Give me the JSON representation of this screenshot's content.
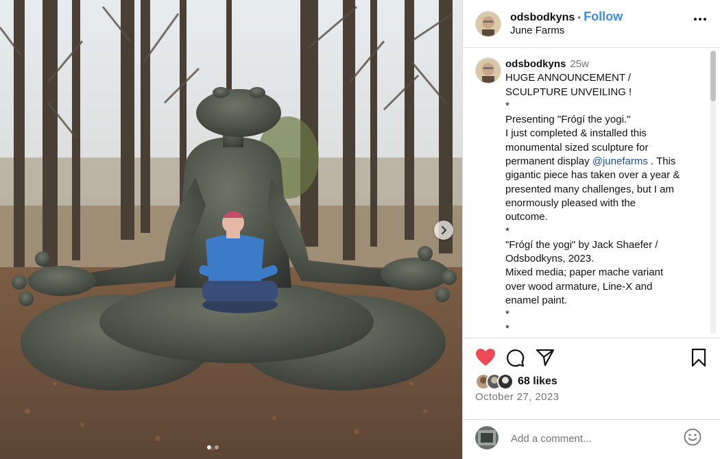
{
  "post": {
    "username": "odsbodkyns",
    "separator": "•",
    "follow_label": "Follow",
    "location": "June Farms"
  },
  "caption": {
    "username": "odsbodkyns",
    "time": "25w",
    "line1": "HUGE ANNOUNCEMENT /",
    "line2": "SCULPTURE UNVEILING !",
    "star1": "*",
    "line3": "Presenting \"Frógí the yogi.\"",
    "line4": "I just completed & installed this",
    "line5": "monumental sized sculpture for",
    "line6_pre": "permanent display ",
    "mention": "@junefarms",
    "line6_post": " . This",
    "line7": "gigantic piece has taken over a year &",
    "line8": "presented many challenges, but I am",
    "line9": "enormously pleased with the",
    "line10": "outcome.",
    "star2": "*",
    "line11": "\"Frógí the yogi\" by Jack Shaefer /",
    "line12": "Odsbodkyns, 2023.",
    "line13": "Mixed media; paper mache variant",
    "line14": "over wood armature, Line-X and",
    "line15": "enamel paint.",
    "star3": "*",
    "star4": "*"
  },
  "engagement": {
    "likes": "68 likes",
    "date": "October 27, 2023"
  },
  "comment": {
    "placeholder": "Add a comment..."
  },
  "carousel": {
    "slide_count": 2,
    "active_index": 0
  },
  "icons": {
    "like": "heart-filled-icon",
    "comment": "comment-bubble-icon",
    "share": "paper-plane-icon",
    "save": "bookmark-icon",
    "more": "more-horizontal-icon",
    "next": "chevron-right-icon",
    "emoji": "smiley-icon"
  },
  "colors": {
    "like": "#ed4956",
    "follow": "#3d8ce6",
    "mention": "#1d4f88",
    "muted": "#737373"
  }
}
